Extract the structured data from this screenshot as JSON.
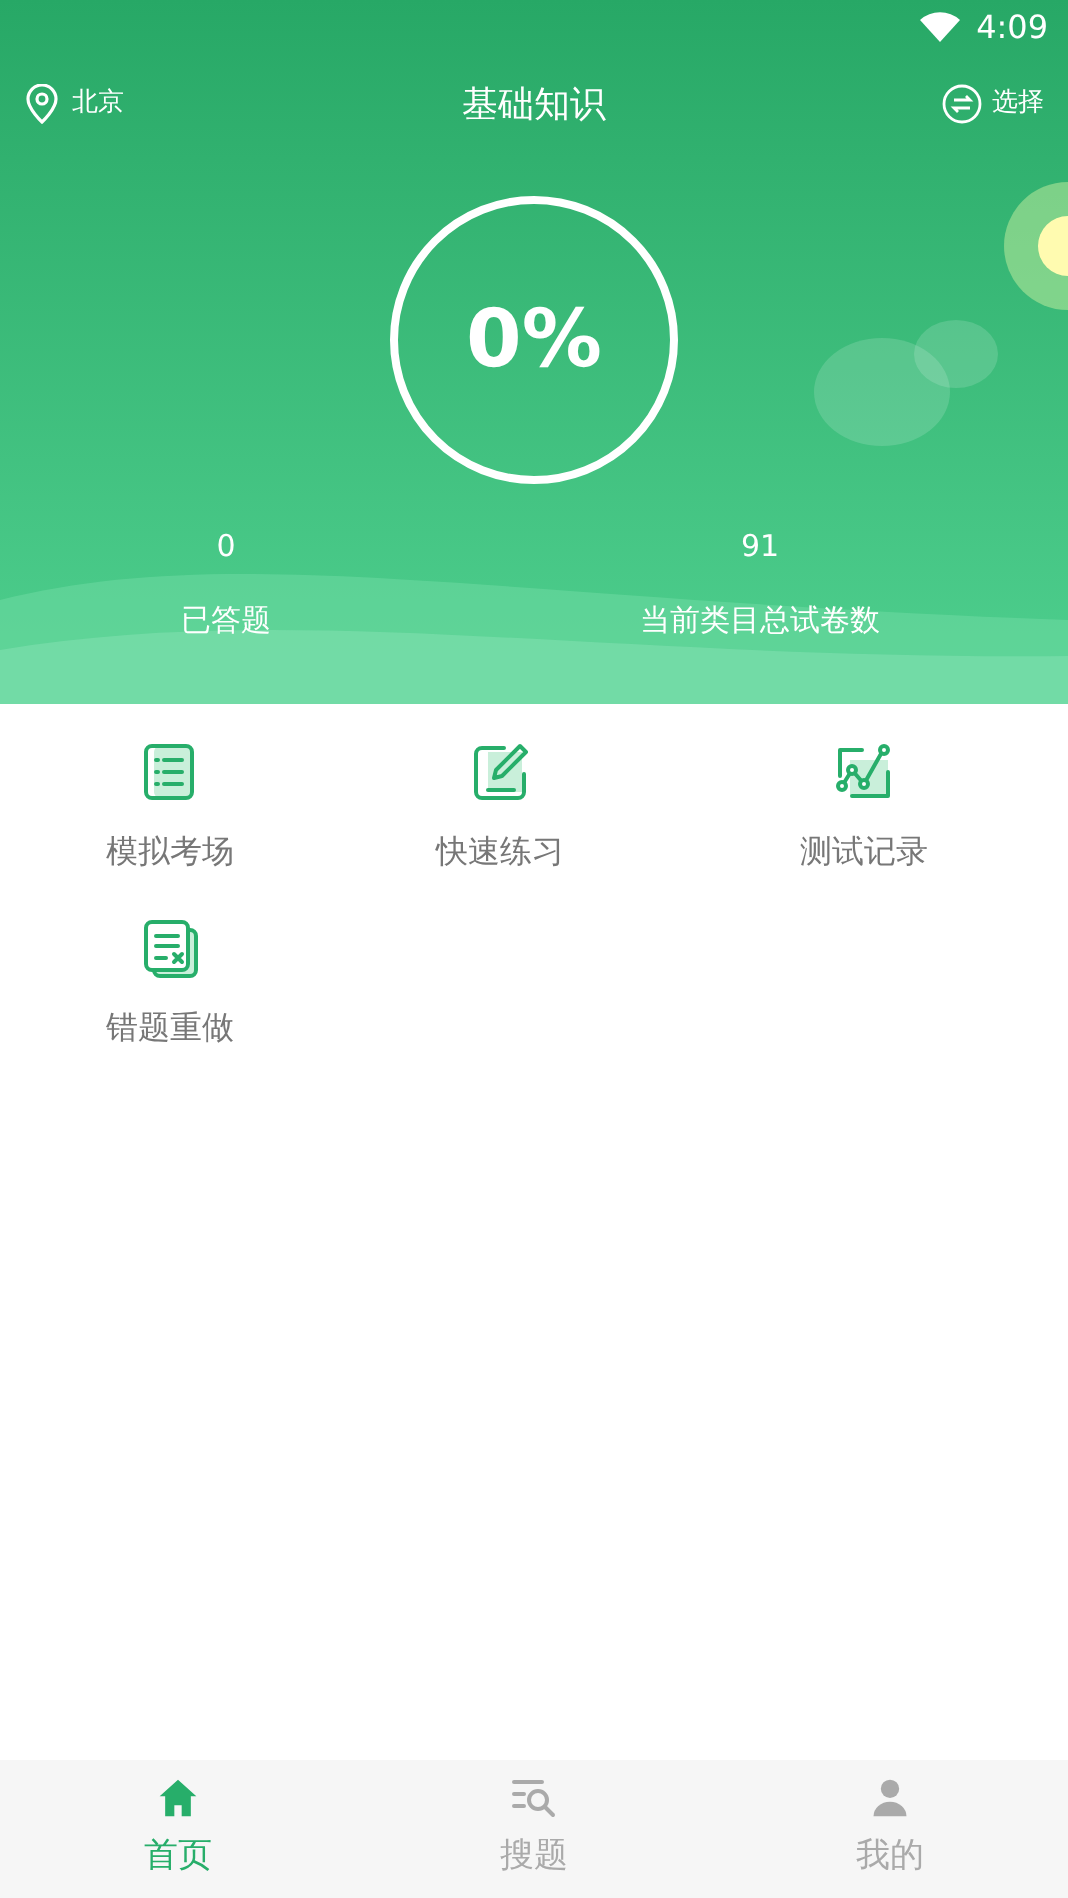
{
  "status_bar": {
    "time": "4:09"
  },
  "header": {
    "location": "北京",
    "title": "基础知识",
    "select": "选择"
  },
  "progress": {
    "percent": "0%",
    "level": 0
  },
  "stats": [
    {
      "value": "0",
      "label": "已答题"
    },
    {
      "value": "91",
      "label": "当前类目总试卷数"
    }
  ],
  "features": [
    {
      "kind": "list",
      "label": "模拟考场"
    },
    {
      "kind": "edit",
      "label": "快速练习"
    },
    {
      "kind": "chart",
      "label": "测试记录"
    },
    {
      "kind": "wrong",
      "label": "错题重做"
    }
  ],
  "tabs": [
    {
      "kind": "home",
      "label": "首页",
      "selected": true
    },
    {
      "kind": "search",
      "label": "搜题",
      "selected": false
    },
    {
      "kind": "user",
      "label": "我的",
      "selected": false
    }
  ]
}
